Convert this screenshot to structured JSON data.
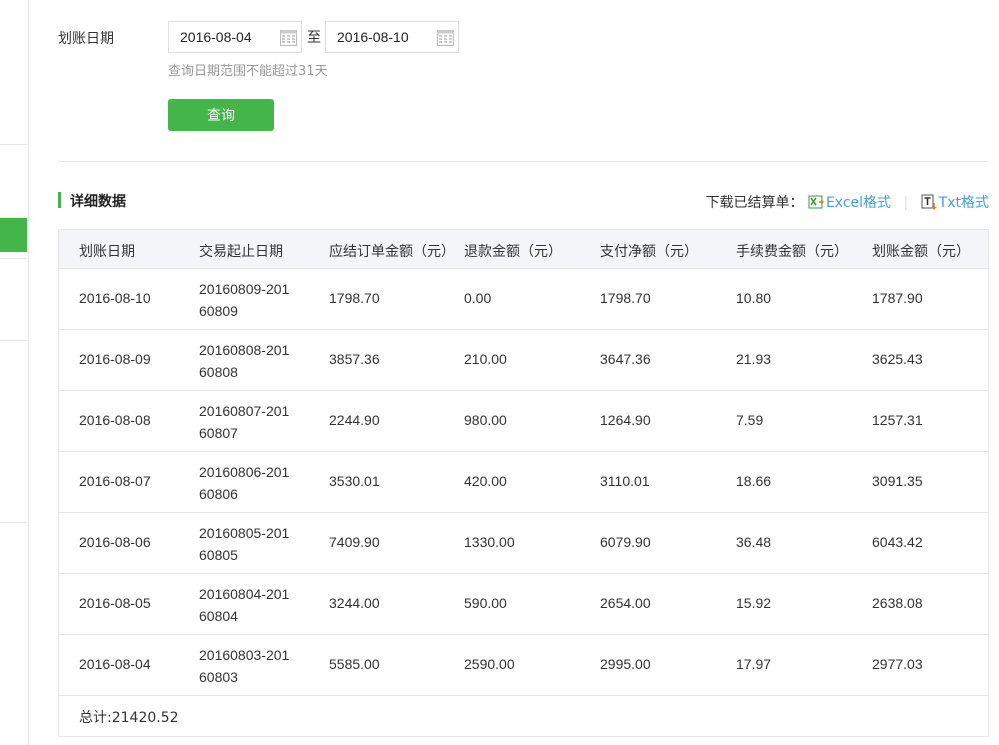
{
  "query": {
    "date_label": "划账日期",
    "start_date": "2016-08-04",
    "to_text": "至",
    "end_date": "2016-08-10",
    "hint": "查询日期范围不能超过31天",
    "query_button": "查询"
  },
  "section": {
    "title": "详细数据",
    "download_label": "下载已结算单：",
    "excel_link": "Excel格式",
    "txt_link": "Txt格式"
  },
  "table": {
    "headers": [
      "划账日期",
      "交易起止日期",
      "应结订单金额（元）",
      "退款金额（元）",
      "支付净额（元）",
      "手续费金额（元）",
      "划账金额（元）"
    ],
    "rows": [
      {
        "date": "2016-08-10",
        "range": "20160809-20160809",
        "order": "1798.70",
        "refund": "0.00",
        "net": "1798.70",
        "fee": "10.80",
        "transfer": "1787.90"
      },
      {
        "date": "2016-08-09",
        "range": "20160808-20160808",
        "order": "3857.36",
        "refund": "210.00",
        "net": "3647.36",
        "fee": "21.93",
        "transfer": "3625.43"
      },
      {
        "date": "2016-08-08",
        "range": "20160807-20160807",
        "order": "2244.90",
        "refund": "980.00",
        "net": "1264.90",
        "fee": "7.59",
        "transfer": "1257.31"
      },
      {
        "date": "2016-08-07",
        "range": "20160806-20160806",
        "order": "3530.01",
        "refund": "420.00",
        "net": "3110.01",
        "fee": "18.66",
        "transfer": "3091.35"
      },
      {
        "date": "2016-08-06",
        "range": "20160805-20160805",
        "order": "7409.90",
        "refund": "1330.00",
        "net": "6079.90",
        "fee": "36.48",
        "transfer": "6043.42"
      },
      {
        "date": "2016-08-05",
        "range": "20160804-20160804",
        "order": "3244.00",
        "refund": "590.00",
        "net": "2654.00",
        "fee": "15.92",
        "transfer": "2638.08"
      },
      {
        "date": "2016-08-04",
        "range": "20160803-20160803",
        "order": "5585.00",
        "refund": "2590.00",
        "net": "2995.00",
        "fee": "17.97",
        "transfer": "2977.03"
      }
    ],
    "total": "总计:21420.52"
  },
  "icons": {
    "calendar": "calendar-icon",
    "excel": "excel-icon",
    "txt": "txt-icon"
  },
  "colors": {
    "accent_green": "#44b549",
    "link_blue": "#459ae9",
    "header_bg": "#f4f5f9"
  }
}
